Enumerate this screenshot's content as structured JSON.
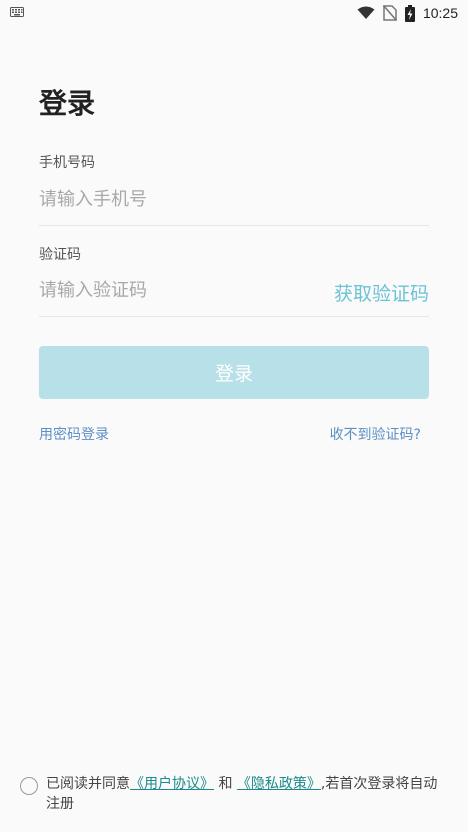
{
  "status_bar": {
    "time": "10:25"
  },
  "page": {
    "title": "登录"
  },
  "phone": {
    "label": "手机号码",
    "placeholder": "请输入手机号"
  },
  "code": {
    "label": "验证码",
    "placeholder": "请输入验证码",
    "get_code": "获取验证码"
  },
  "login_button": "登录",
  "links": {
    "password_login": "用密码登录",
    "no_code": "收不到验证码?"
  },
  "agreement": {
    "prefix": "已阅读并同意",
    "user_agreement": "《用户协议》",
    "and": "和",
    "privacy_policy": "《隐私政策》",
    "suffix": ",若首次登录将自动注册"
  },
  "colors": {
    "accent": "#6cc3d5",
    "button_disabled": "#b8e0e8",
    "link": "#5d8fc5",
    "agreement_link": "#1a8b8a"
  },
  "icons": [
    "keyboard-icon",
    "wifi-icon",
    "no-sim-icon",
    "battery-charging-icon"
  ]
}
